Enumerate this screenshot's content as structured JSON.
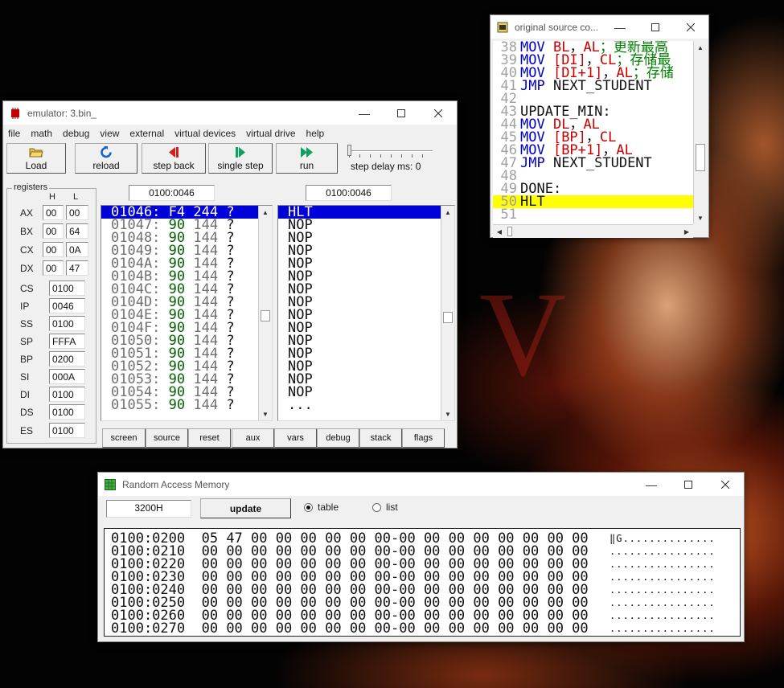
{
  "wallpaper": {
    "letter": "V"
  },
  "emulator": {
    "title": "emulator: 3.bin_",
    "menu": [
      "file",
      "math",
      "debug",
      "view",
      "external",
      "virtual devices",
      "virtual drive",
      "help"
    ],
    "toolbar": {
      "load": "Load",
      "reload": "reload",
      "step_back": "step back",
      "single_step": "single step",
      "run": "run",
      "step_delay": "step delay ms: 0"
    },
    "registers": {
      "legend": "registers",
      "h_label": "H",
      "l_label": "L",
      "general": [
        {
          "name": "AX",
          "h": "00",
          "l": "00"
        },
        {
          "name": "BX",
          "h": "00",
          "l": "64"
        },
        {
          "name": "CX",
          "h": "00",
          "l": "0A"
        },
        {
          "name": "DX",
          "h": "00",
          "l": "47"
        }
      ],
      "segment": [
        {
          "name": "CS",
          "value": "0100"
        },
        {
          "name": "IP",
          "value": "0046"
        },
        {
          "name": "SS",
          "value": "0100"
        },
        {
          "name": "SP",
          "value": "FFFA"
        },
        {
          "name": "BP",
          "value": "0200"
        },
        {
          "name": "SI",
          "value": "000A"
        },
        {
          "name": "DI",
          "value": "0100"
        },
        {
          "name": "DS",
          "value": "0100"
        },
        {
          "name": "ES",
          "value": "0100"
        }
      ]
    },
    "memory_address": "0100:0046",
    "disasm_address": "0100:0046",
    "memory_rows": [
      {
        "addr": "01046:",
        "hex": "F4",
        "dec": "244",
        "ch": "?"
      },
      {
        "addr": "01047:",
        "hex": "90",
        "dec": "144",
        "ch": "?"
      },
      {
        "addr": "01048:",
        "hex": "90",
        "dec": "144",
        "ch": "?"
      },
      {
        "addr": "01049:",
        "hex": "90",
        "dec": "144",
        "ch": "?"
      },
      {
        "addr": "0104A:",
        "hex": "90",
        "dec": "144",
        "ch": "?"
      },
      {
        "addr": "0104B:",
        "hex": "90",
        "dec": "144",
        "ch": "?"
      },
      {
        "addr": "0104C:",
        "hex": "90",
        "dec": "144",
        "ch": "?"
      },
      {
        "addr": "0104D:",
        "hex": "90",
        "dec": "144",
        "ch": "?"
      },
      {
        "addr": "0104E:",
        "hex": "90",
        "dec": "144",
        "ch": "?"
      },
      {
        "addr": "0104F:",
        "hex": "90",
        "dec": "144",
        "ch": "?"
      },
      {
        "addr": "01050:",
        "hex": "90",
        "dec": "144",
        "ch": "?"
      },
      {
        "addr": "01051:",
        "hex": "90",
        "dec": "144",
        "ch": "?"
      },
      {
        "addr": "01052:",
        "hex": "90",
        "dec": "144",
        "ch": "?"
      },
      {
        "addr": "01053:",
        "hex": "90",
        "dec": "144",
        "ch": "?"
      },
      {
        "addr": "01054:",
        "hex": "90",
        "dec": "144",
        "ch": "?"
      },
      {
        "addr": "01055:",
        "hex": "90",
        "dec": "144",
        "ch": "?"
      }
    ],
    "disasm_rows": [
      "HLT",
      "NOP",
      "NOP",
      "NOP",
      "NOP",
      "NOP",
      "NOP",
      "NOP",
      "NOP",
      "NOP",
      "NOP",
      "NOP",
      "NOP",
      "NOP",
      "NOP",
      "..."
    ],
    "bottom_buttons": [
      "screen",
      "source",
      "reset",
      "aux",
      "vars",
      "debug",
      "stack",
      "flags"
    ]
  },
  "source": {
    "title": "original source co...",
    "lines": [
      {
        "n": "38",
        "tokens": [
          [
            "kw",
            "MOV "
          ],
          [
            "reg",
            "BL"
          ],
          [
            "",
            "，"
          ],
          [
            "reg",
            "AL"
          ],
          [
            "cm",
            "；更新最高"
          ]
        ]
      },
      {
        "n": "39",
        "tokens": [
          [
            "kw",
            "MOV "
          ],
          [
            "reg",
            "[DI]"
          ],
          [
            "",
            "，"
          ],
          [
            "reg",
            "CL"
          ],
          [
            "cm",
            "；存储最"
          ]
        ]
      },
      {
        "n": "40",
        "tokens": [
          [
            "kw",
            "MOV "
          ],
          [
            "reg",
            "[DI+1]"
          ],
          [
            "",
            "，"
          ],
          [
            "reg",
            "AL"
          ],
          [
            "cm",
            "；存储"
          ]
        ]
      },
      {
        "n": "41",
        "tokens": [
          [
            "kw",
            "JMP "
          ],
          [
            "",
            "NEXT_STUDENT"
          ]
        ]
      },
      {
        "n": "42",
        "tokens": []
      },
      {
        "n": "43",
        "tokens": [
          [
            "",
            "UPDATE_MIN:"
          ]
        ]
      },
      {
        "n": "44",
        "tokens": [
          [
            "kw",
            "MOV "
          ],
          [
            "reg",
            "DL"
          ],
          [
            "",
            "，"
          ],
          [
            "reg",
            "AL"
          ]
        ]
      },
      {
        "n": "45",
        "tokens": [
          [
            "kw",
            "MOV "
          ],
          [
            "reg",
            "[BP]"
          ],
          [
            "",
            "，"
          ],
          [
            "reg",
            "CL"
          ]
        ]
      },
      {
        "n": "46",
        "tokens": [
          [
            "kw",
            "MOV "
          ],
          [
            "reg",
            "[BP+1]"
          ],
          [
            "",
            "，"
          ],
          [
            "reg",
            "AL"
          ]
        ]
      },
      {
        "n": "47",
        "tokens": [
          [
            "kw",
            "JMP "
          ],
          [
            "",
            "NEXT_STUDENT"
          ]
        ]
      },
      {
        "n": "48",
        "tokens": []
      },
      {
        "n": "49",
        "tokens": [
          [
            "",
            "DONE:"
          ]
        ]
      },
      {
        "n": "50",
        "tokens": [
          [
            "",
            "HLT"
          ]
        ],
        "highlight": true
      },
      {
        "n": "51",
        "tokens": []
      }
    ]
  },
  "ram": {
    "title": "Random Access Memory",
    "address": "3200H",
    "update": "update",
    "view_table": "table",
    "view_list": "list",
    "rows": [
      {
        "addr": "0100:0200",
        "bytes": "05 47 00 00 00 00 00 00-00 00 00 00 00 00 00 00",
        "ascii": "‖G.............."
      },
      {
        "addr": "0100:0210",
        "bytes": "00 00 00 00 00 00 00 00-00 00 00 00 00 00 00 00",
        "ascii": "................"
      },
      {
        "addr": "0100:0220",
        "bytes": "00 00 00 00 00 00 00 00-00 00 00 00 00 00 00 00",
        "ascii": "................"
      },
      {
        "addr": "0100:0230",
        "bytes": "00 00 00 00 00 00 00 00-00 00 00 00 00 00 00 00",
        "ascii": "................"
      },
      {
        "addr": "0100:0240",
        "bytes": "00 00 00 00 00 00 00 00-00 00 00 00 00 00 00 00",
        "ascii": "................"
      },
      {
        "addr": "0100:0250",
        "bytes": "00 00 00 00 00 00 00 00-00 00 00 00 00 00 00 00",
        "ascii": "................"
      },
      {
        "addr": "0100:0260",
        "bytes": "00 00 00 00 00 00 00 00-00 00 00 00 00 00 00 00",
        "ascii": "................"
      },
      {
        "addr": "0100:0270",
        "bytes": "00 00 00 00 00 00 00 00-00 00 00 00 00 00 00 00",
        "ascii": "................"
      }
    ]
  },
  "colors": {
    "selection": "#0000d8",
    "hex_green": "#006400",
    "keyword_blue": "#0000c8",
    "register_red": "#c80000",
    "comment_green": "#008000",
    "current_line": "#ffff00"
  }
}
